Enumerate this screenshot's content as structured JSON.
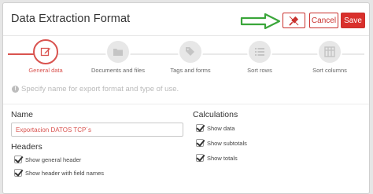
{
  "dialog": {
    "title": "Data Extraction Format",
    "cancel_label": "Cancel",
    "save_label": "Save",
    "plug_icon": "unplug-icon"
  },
  "steps": [
    {
      "label": "General data",
      "icon": "edit-icon",
      "active": true
    },
    {
      "label": "Documents and files",
      "icon": "folder-icon",
      "active": false
    },
    {
      "label": "Tags and forms",
      "icon": "tags-icon",
      "active": false
    },
    {
      "label": "Sort rows",
      "icon": "list-icon",
      "active": false
    },
    {
      "label": "Sort columns",
      "icon": "columns-icon",
      "active": false
    }
  ],
  "hint": "Specify name for export format and type of use.",
  "name_section": {
    "title": "Name",
    "value": "Exportacion DATOS TCP´s"
  },
  "headers_section": {
    "title": "Headers",
    "options": [
      {
        "label": "Show general header",
        "checked": true
      },
      {
        "label": "Show header with field names",
        "checked": true
      }
    ]
  },
  "calculations_section": {
    "title": "Calculations",
    "options": [
      {
        "label": "Show data",
        "checked": true
      },
      {
        "label": "Show subtotals",
        "checked": true
      },
      {
        "label": "Show totals",
        "checked": true
      }
    ]
  },
  "colors": {
    "accent": "#d9534f",
    "annotation_arrow": "#3aa63a"
  }
}
